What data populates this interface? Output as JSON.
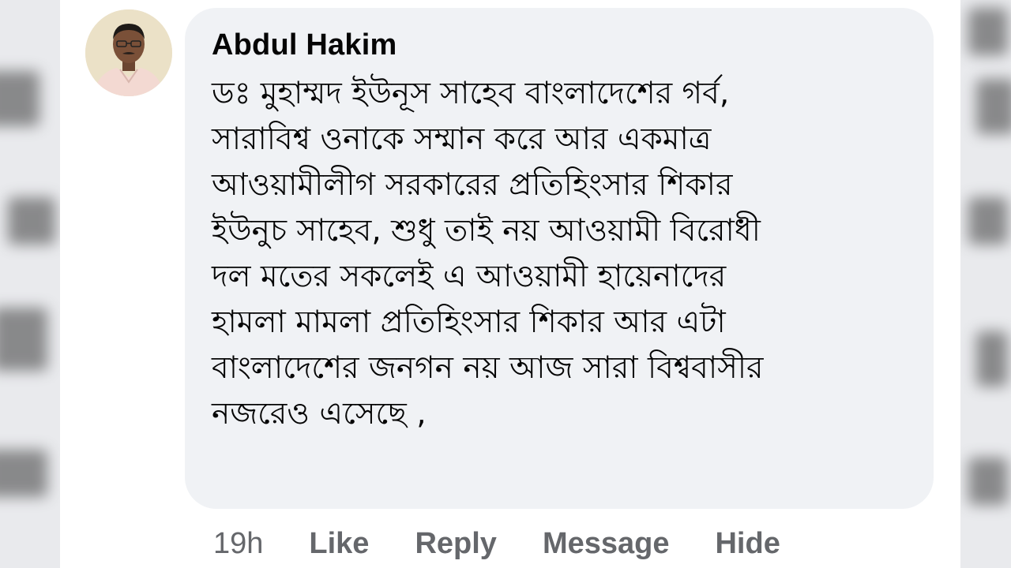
{
  "comment": {
    "author": "Abdul Hakim",
    "lines": [
      "ডঃ মুহাম্মদ ইউনূস সাহেব বাংলাদেশের গর্ব,",
      "সারাবিশ্ব ওনাকে সম্মান করে আর একমাত্র",
      "আওয়ামীলীগ সরকারের প্রতিহিংসার শিকার",
      "ইউনুচ সাহেব, শুধু তাই নয় আওয়ামী বিরোধী",
      "দল মতের সকলেই এ আওয়ামী হায়েনাদের",
      "হামলা মামলা প্রতিহিংসার শিকার আর এটা",
      "বাংলাদেশের জনগন নয় আজ সারা বিশ্ববাসীর",
      "নজরেও এসেছে ,"
    ]
  },
  "actions": {
    "time": "19h",
    "like": "Like",
    "reply": "Reply",
    "message": "Message",
    "hide": "Hide"
  },
  "colors": {
    "bubble": "#f0f2f5",
    "text": "#050505",
    "meta": "#65676b"
  }
}
